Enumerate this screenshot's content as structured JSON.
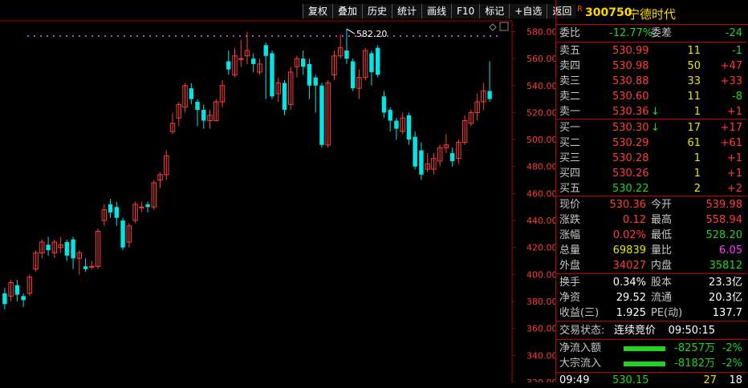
{
  "toolbar": [
    "复权",
    "叠加",
    "历史",
    "统计",
    "画线",
    "F10",
    "标记",
    "+自选",
    "返回"
  ],
  "chart_data": {
    "type": "candlestick",
    "y_ticks": [
      580.0,
      560.0,
      540.0,
      520.0,
      500.0,
      480.0,
      460.0,
      440.0,
      420.0,
      400.0,
      380.0,
      360.0,
      340.0,
      320.0
    ],
    "ylim": [
      320,
      588
    ],
    "high_annotation": "582.20",
    "candles": [
      {
        "o": 386,
        "c": 378,
        "h": 390,
        "l": 374
      },
      {
        "o": 384,
        "c": 394,
        "h": 396,
        "l": 380
      },
      {
        "o": 392,
        "c": 385,
        "h": 396,
        "l": 380
      },
      {
        "o": 384,
        "c": 381,
        "h": 386,
        "l": 376
      },
      {
        "o": 386,
        "c": 398,
        "h": 400,
        "l": 384
      },
      {
        "o": 404,
        "c": 416,
        "h": 418,
        "l": 402
      },
      {
        "o": 416,
        "c": 424,
        "h": 426,
        "l": 412
      },
      {
        "o": 422,
        "c": 418,
        "h": 428,
        "l": 414
      },
      {
        "o": 416,
        "c": 424,
        "h": 426,
        "l": 412
      },
      {
        "o": 420,
        "c": 422,
        "h": 428,
        "l": 416
      },
      {
        "o": 424,
        "c": 414,
        "h": 426,
        "l": 410
      },
      {
        "o": 426,
        "c": 412,
        "h": 428,
        "l": 404
      },
      {
        "o": 412,
        "c": 416,
        "h": 418,
        "l": 400
      },
      {
        "o": 406,
        "c": 404,
        "h": 412,
        "l": 402
      },
      {
        "o": 406,
        "c": 406,
        "h": 410,
        "l": 404
      },
      {
        "o": 406,
        "c": 432,
        "h": 434,
        "l": 404
      },
      {
        "o": 440,
        "c": 448,
        "h": 452,
        "l": 436
      },
      {
        "o": 452,
        "c": 446,
        "h": 456,
        "l": 442
      },
      {
        "o": 450,
        "c": 442,
        "h": 454,
        "l": 436
      },
      {
        "o": 440,
        "c": 420,
        "h": 442,
        "l": 418
      },
      {
        "o": 424,
        "c": 436,
        "h": 438,
        "l": 420
      },
      {
        "o": 440,
        "c": 452,
        "h": 454,
        "l": 438
      },
      {
        "o": 450,
        "c": 450,
        "h": 454,
        "l": 446
      },
      {
        "o": 452,
        "c": 450,
        "h": 454,
        "l": 446
      },
      {
        "o": 450,
        "c": 468,
        "h": 470,
        "l": 448
      },
      {
        "o": 470,
        "c": 474,
        "h": 476,
        "l": 464
      },
      {
        "o": 474,
        "c": 488,
        "h": 492,
        "l": 470
      },
      {
        "o": 506,
        "c": 512,
        "h": 520,
        "l": 504
      },
      {
        "o": 516,
        "c": 526,
        "h": 528,
        "l": 510
      },
      {
        "o": 524,
        "c": 540,
        "h": 542,
        "l": 520
      },
      {
        "o": 538,
        "c": 530,
        "h": 542,
        "l": 526
      },
      {
        "o": 528,
        "c": 522,
        "h": 530,
        "l": 510
      },
      {
        "o": 522,
        "c": 514,
        "h": 526,
        "l": 508
      },
      {
        "o": 514,
        "c": 518,
        "h": 522,
        "l": 508
      },
      {
        "o": 514,
        "c": 528,
        "h": 530,
        "l": 514
      },
      {
        "o": 528,
        "c": 540,
        "h": 544,
        "l": 524
      },
      {
        "o": 558,
        "c": 552,
        "h": 566,
        "l": 548
      },
      {
        "o": 548,
        "c": 562,
        "h": 568,
        "l": 546
      },
      {
        "o": 560,
        "c": 560,
        "h": 574,
        "l": 554
      },
      {
        "o": 562,
        "c": 566,
        "h": 580,
        "l": 556
      },
      {
        "o": 560,
        "c": 556,
        "h": 564,
        "l": 550
      },
      {
        "o": 550,
        "c": 556,
        "h": 560,
        "l": 548
      },
      {
        "o": 570,
        "c": 562,
        "h": 572,
        "l": 530
      },
      {
        "o": 564,
        "c": 532,
        "h": 566,
        "l": 530
      },
      {
        "o": 534,
        "c": 542,
        "h": 546,
        "l": 528
      },
      {
        "o": 542,
        "c": 522,
        "h": 544,
        "l": 518
      },
      {
        "o": 526,
        "c": 550,
        "h": 554,
        "l": 522
      },
      {
        "o": 554,
        "c": 560,
        "h": 562,
        "l": 546
      },
      {
        "o": 560,
        "c": 554,
        "h": 566,
        "l": 548
      },
      {
        "o": 556,
        "c": 540,
        "h": 560,
        "l": 530
      },
      {
        "o": 546,
        "c": 540,
        "h": 548,
        "l": 520
      },
      {
        "o": 540,
        "c": 496,
        "h": 542,
        "l": 494
      },
      {
        "o": 496,
        "c": 542,
        "h": 544,
        "l": 494
      },
      {
        "o": 548,
        "c": 562,
        "h": 566,
        "l": 544
      },
      {
        "o": 562,
        "c": 568,
        "h": 578,
        "l": 560
      },
      {
        "o": 566,
        "c": 560,
        "h": 582,
        "l": 556
      },
      {
        "o": 558,
        "c": 538,
        "h": 560,
        "l": 536
      },
      {
        "o": 538,
        "c": 546,
        "h": 552,
        "l": 530
      },
      {
        "o": 546,
        "c": 566,
        "h": 568,
        "l": 544
      },
      {
        "o": 564,
        "c": 550,
        "h": 566,
        "l": 540
      },
      {
        "o": 568,
        "c": 548,
        "h": 570,
        "l": 546
      },
      {
        "o": 532,
        "c": 520,
        "h": 536,
        "l": 516
      },
      {
        "o": 522,
        "c": 514,
        "h": 524,
        "l": 506
      },
      {
        "o": 514,
        "c": 508,
        "h": 516,
        "l": 500
      },
      {
        "o": 506,
        "c": 516,
        "h": 520,
        "l": 504
      },
      {
        "o": 518,
        "c": 500,
        "h": 520,
        "l": 496
      },
      {
        "o": 502,
        "c": 480,
        "h": 506,
        "l": 478
      },
      {
        "o": 492,
        "c": 474,
        "h": 498,
        "l": 470
      },
      {
        "o": 478,
        "c": 482,
        "h": 490,
        "l": 476
      },
      {
        "o": 478,
        "c": 486,
        "h": 490,
        "l": 474
      },
      {
        "o": 484,
        "c": 494,
        "h": 496,
        "l": 480
      },
      {
        "o": 494,
        "c": 496,
        "h": 504,
        "l": 490
      },
      {
        "o": 490,
        "c": 484,
        "h": 494,
        "l": 480
      },
      {
        "o": 486,
        "c": 498,
        "h": 500,
        "l": 482
      },
      {
        "o": 498,
        "c": 514,
        "h": 518,
        "l": 496
      },
      {
        "o": 512,
        "c": 520,
        "h": 522,
        "l": 510
      },
      {
        "o": 520,
        "c": 528,
        "h": 534,
        "l": 514
      },
      {
        "o": 528,
        "c": 536,
        "h": 542,
        "l": 522
      },
      {
        "o": 536,
        "c": 530,
        "h": 558,
        "l": 528
      }
    ]
  },
  "stock": {
    "code": "300750",
    "name": "宁德时代",
    "badge": "R"
  },
  "weibi": {
    "label": "委比",
    "value": "-12.77%",
    "label2": "委差",
    "value2": "-24"
  },
  "asks": [
    {
      "label": "卖五",
      "price": "530.99",
      "vol": "11",
      "chg": "-1"
    },
    {
      "label": "卖四",
      "price": "530.98",
      "vol": "50",
      "chg": "+47"
    },
    {
      "label": "卖三",
      "price": "530.88",
      "vol": "33",
      "chg": "+33"
    },
    {
      "label": "卖二",
      "price": "530.60",
      "vol": "11",
      "chg": "-8"
    },
    {
      "label": "卖一",
      "price": "530.36",
      "vol": "1",
      "chg": "+1",
      "arrow": "↓"
    }
  ],
  "bids": [
    {
      "label": "买一",
      "price": "530.30",
      "vol": "17",
      "chg": "+17",
      "arrow": "↓"
    },
    {
      "label": "买二",
      "price": "530.29",
      "vol": "61",
      "chg": "+61"
    },
    {
      "label": "买三",
      "price": "530.28",
      "vol": "1",
      "chg": "+1"
    },
    {
      "label": "买四",
      "price": "530.26",
      "vol": "1",
      "chg": "+1"
    },
    {
      "label": "买五",
      "price": "530.22",
      "vol": "2",
      "chg": "+2"
    }
  ],
  "quote": [
    {
      "l1": "现价",
      "v1": "530.36",
      "l2": "今开",
      "v2": "539.98"
    },
    {
      "l1": "涨跌",
      "v1": "0.12",
      "l2": "最高",
      "v2": "558.94"
    },
    {
      "l1": "涨幅",
      "v1": "0.02%",
      "l2": "最低",
      "v2": "528.20"
    },
    {
      "l1": "总量",
      "v1": "69839",
      "l2": "量比",
      "v2": "6.05"
    },
    {
      "l1": "外盘",
      "v1": "34027",
      "l2": "内盘",
      "v2": "35812"
    }
  ],
  "fund": [
    {
      "l1": "换手",
      "v1": "0.34%",
      "l2": "股本",
      "v2": "23.3亿"
    },
    {
      "l1": "净资",
      "v1": "29.52",
      "l2": "流通",
      "v2": "20.3亿"
    },
    {
      "l1": "收益(三)",
      "v1": "1.925",
      "l2": "PE(动)",
      "v2": "137.7"
    }
  ],
  "status": {
    "label": "交易状态:",
    "value": "连续竞价",
    "time": "09:50:15"
  },
  "flows": [
    {
      "label": "净流入额",
      "value": "-8257万",
      "pct": "-2%"
    },
    {
      "label": "大宗流入",
      "value": "-8182万",
      "pct": "-2%"
    }
  ],
  "tick": {
    "time": "09:49",
    "price": "530.15",
    "vol": "27",
    "n": "18"
  },
  "colors": {
    "up": "#ff3b3b",
    "down": "#00e5e5",
    "accent": "#b00000"
  }
}
